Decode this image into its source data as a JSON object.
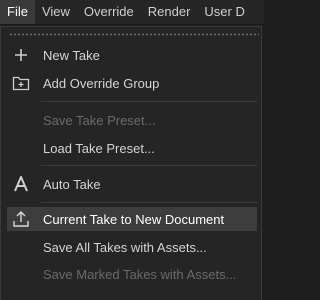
{
  "menubar": {
    "items": [
      {
        "label": "File"
      },
      {
        "label": "View"
      },
      {
        "label": "Override"
      },
      {
        "label": "Render"
      },
      {
        "label": "User D"
      }
    ]
  },
  "menu": {
    "items": [
      {
        "label": "New Take",
        "icon": "plus-icon",
        "enabled": true
      },
      {
        "label": "Add Override Group",
        "icon": "add-folder-icon",
        "enabled": true
      },
      {
        "label": "Save Take Preset...",
        "enabled": false
      },
      {
        "label": "Load Take Preset...",
        "enabled": true
      },
      {
        "label": "Auto Take",
        "icon": "auto-take-icon",
        "enabled": true
      },
      {
        "label": "Current Take to New Document",
        "icon": "export-icon",
        "enabled": true
      },
      {
        "label": "Save All Takes with Assets...",
        "enabled": true
      },
      {
        "label": "Save Marked Takes with Assets...",
        "enabled": false
      }
    ]
  }
}
